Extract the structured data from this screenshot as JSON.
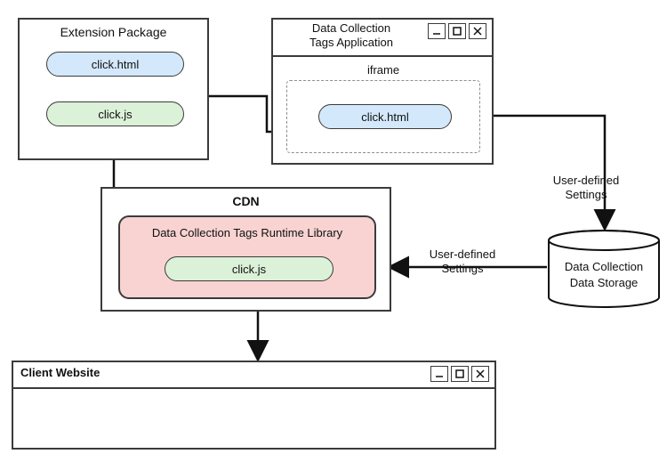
{
  "extension_package": {
    "title": "Extension Package",
    "click_html": "click.html",
    "click_js": "click.js"
  },
  "tags_app": {
    "title": "Data Collection\nTags Application",
    "iframe_label": "iframe",
    "iframe_content": "click.html"
  },
  "cdn": {
    "title": "CDN",
    "runtime_title": "Data Collection Tags Runtime Library",
    "click_js": "click.js"
  },
  "settings_label_1": "User-defined\nSettings",
  "settings_label_2": "User-defined\nSettings",
  "db": {
    "line1": "Data Collection",
    "line2": "Data Storage"
  },
  "client_site": {
    "title": "Client Website"
  }
}
